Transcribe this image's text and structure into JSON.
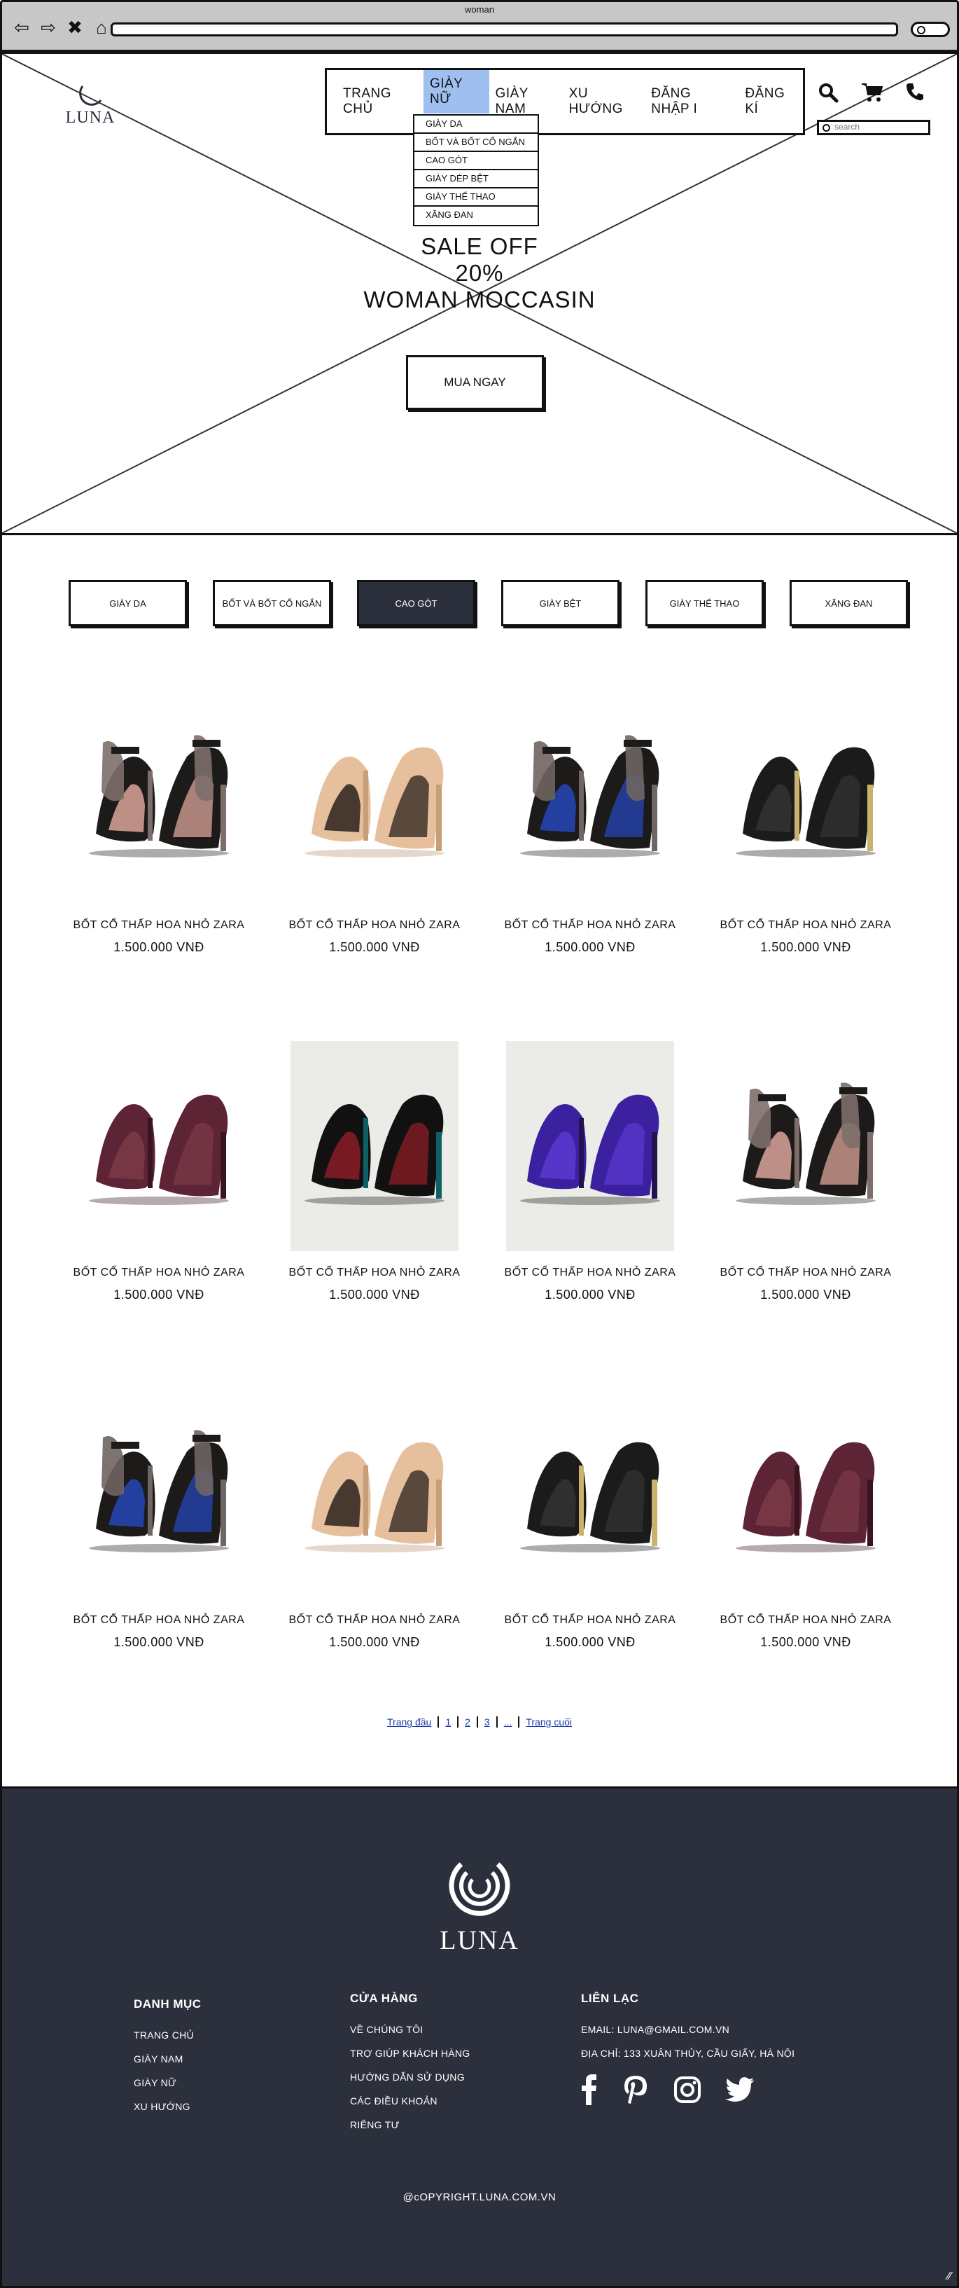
{
  "browser": {
    "title": "woman"
  },
  "brand": {
    "name": "LUNA"
  },
  "menu": [
    "TRANG CHỦ",
    "GIÀY NỮ",
    "GIÀY NAM",
    "XU HƯỚNG",
    "ĐĂNG NHẬP I",
    "ĐĂNG KÍ"
  ],
  "dropdown": [
    "GIÀY DA",
    "BỐT VÀ BỐT CỔ NGẮN",
    "CAO GÓT",
    "GIÀY DÉP BỆT",
    "GIÀY THỂ THAO",
    "XĂNG ĐAN"
  ],
  "search": {
    "placeholder": "search"
  },
  "hero": {
    "line1": "SALE OFF",
    "line2": "20%",
    "line3": "WOMAN MOCCASIN",
    "button": "MUA NGAY"
  },
  "categories": [
    "GIÀY DA",
    "BỐT VÀ BỐT CỔ NGẮN",
    "CAO GÓT",
    "GIÀY BỆT",
    "GIÀY THỂ THAO",
    "XĂNG ĐAN"
  ],
  "products": [
    {
      "name": "BỐT CỔ THẤP HOA NHỎ ZARA",
      "price": "1.500.000 VNĐ",
      "style": "lace-strap"
    },
    {
      "name": "BỐT CỔ THẤP HOA NHỎ ZARA",
      "price": "1.500.000 VNĐ",
      "style": "nude-peeptoe"
    },
    {
      "name": "BỐT CỔ THẤP HOA NHỎ ZARA",
      "price": "1.500.000 VNĐ",
      "style": "blue-strap"
    },
    {
      "name": "BỐT CỔ THẤP HOA NHỎ ZARA",
      "price": "1.500.000 VNĐ",
      "style": "black-glitter"
    },
    {
      "name": "BỐT CỔ THẤP HOA NHỎ ZARA",
      "price": "1.500.000 VNĐ",
      "style": "burgundy-bow"
    },
    {
      "name": "BỐT CỔ THẤP HOA NHỎ ZARA",
      "price": "1.500.000 VNĐ",
      "style": "teal-flat"
    },
    {
      "name": "BỐT CỔ THẤP HOA NHỎ ZARA",
      "price": "1.500.000 VNĐ",
      "style": "purple-heel"
    },
    {
      "name": "BỐT CỔ THẤP HOA NHỎ ZARA",
      "price": "1.500.000 VNĐ",
      "style": "lace-strap"
    },
    {
      "name": "BỐT CỔ THẤP HOA NHỎ ZARA",
      "price": "1.500.000 VNĐ",
      "style": "blue-strap"
    },
    {
      "name": "BỐT CỔ THẤP HOA NHỎ ZARA",
      "price": "1.500.000 VNĐ",
      "style": "nude-peeptoe"
    },
    {
      "name": "BỐT CỔ THẤP HOA NHỎ ZARA",
      "price": "1.500.000 VNĐ",
      "style": "black-glitter"
    },
    {
      "name": "BỐT CỔ THẤP HOA NHỎ ZARA",
      "price": "1.500.000 VNĐ",
      "style": "burgundy-bow"
    }
  ],
  "pagination": [
    "Trang đầu",
    "1",
    "2",
    "3",
    "...",
    "Trang cuối"
  ],
  "footer": {
    "col1": {
      "title": "DANH MỤC",
      "links": [
        "TRANG CHỦ",
        "GIÀY NAM",
        "GIÀY NỮ",
        "XU HƯỚNG"
      ]
    },
    "col2": {
      "title": "CỬA HÀNG",
      "links": [
        "VỀ CHÚNG TÔI",
        "TRỢ GIÚP KHÁCH HÀNG",
        "HƯỚNG DẪN SỬ DỤNG",
        "CÁC ĐIỀU KHOẢN",
        "RIÊNG TƯ"
      ]
    },
    "col3": {
      "title": "LIÊN LẠC",
      "email": "EMAIL: LUNA@GMAIL.COM.VN",
      "address": "ĐỊA CHỈ: 133 XUÂN THỦY, CẦU GIẤY, HÀ NỘI"
    },
    "socials": [
      "facebook-icon",
      "pinterest-icon",
      "instagram-icon",
      "twitter-icon"
    ],
    "copyright": "@cOPYRIGHT.LUNA.COM.VN"
  },
  "colors": {
    "dark": "#2b303c",
    "highlight": "#9fbff0",
    "link": "#1d3aa8"
  }
}
